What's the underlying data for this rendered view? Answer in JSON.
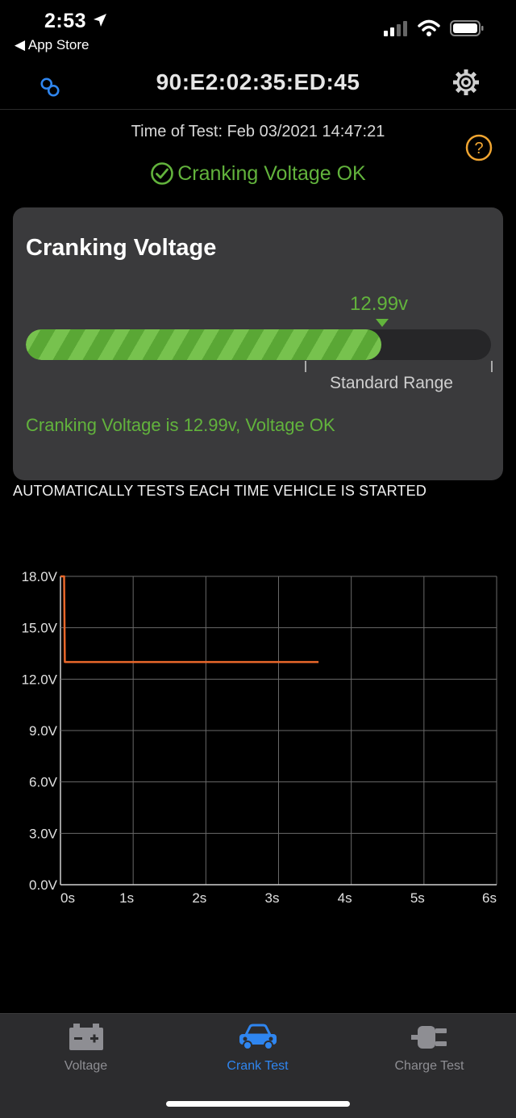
{
  "status_bar": {
    "time": "2:53",
    "back_label": "App Store"
  },
  "header": {
    "title": "90:E2:02:35:ED:45"
  },
  "test": {
    "time_label": "Time of Test:",
    "time_value": "Feb 03/2021 14:47:21",
    "result": "Cranking Voltage OK"
  },
  "card": {
    "title": "Cranking Voltage",
    "reading_label": "12.99v",
    "progress_fraction": 0.765,
    "range_label": "Standard Range",
    "summary": "Cranking Voltage is 12.99v, Voltage OK"
  },
  "note": "AUTOMATICALLY TESTS EACH TIME VEHICLE IS STARTED",
  "colors": {
    "accent_green": "#62b33c",
    "series_orange": "#e8672a",
    "tab_active_blue": "#2f86f0",
    "help_orange": "#f0a531"
  },
  "chart_data": {
    "type": "line",
    "xlim": [
      0,
      6
    ],
    "ylim": [
      0,
      18
    ],
    "x_ticks": [
      "0s",
      "1s",
      "2s",
      "3s",
      "4s",
      "5s",
      "6s"
    ],
    "y_ticks": [
      "0.0V",
      "3.0V",
      "6.0V",
      "9.0V",
      "12.0V",
      "15.0V",
      "18.0V"
    ],
    "grid": true,
    "series": [
      {
        "x": [
          0,
          0.05,
          0.06,
          3.55
        ],
        "y": [
          18,
          18,
          13.0,
          13.0
        ]
      }
    ]
  },
  "tabs": [
    {
      "label": "Voltage",
      "icon": "battery-icon",
      "active": false
    },
    {
      "label": "Crank Test",
      "icon": "car-icon",
      "active": true
    },
    {
      "label": "Charge Test",
      "icon": "plug-icon",
      "active": false
    }
  ]
}
